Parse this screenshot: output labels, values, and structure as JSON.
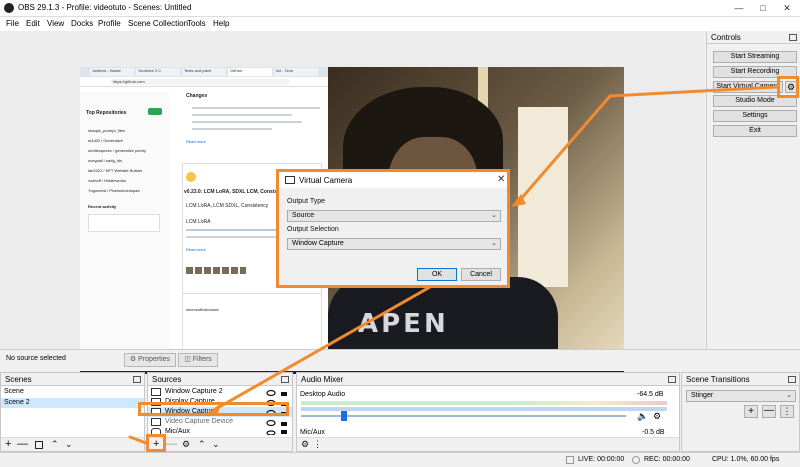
{
  "window": {
    "title": "OBS 29.1.3 - Profile: videotuto - Scenes: Untitled"
  },
  "menu": [
    "File",
    "Edit",
    "View",
    "Docks",
    "Profile",
    "Scene Collection",
    "Tools",
    "Help"
  ],
  "preview": {
    "browser_tabs": [
      "Justfont - Hacke",
      "Yourtube 2.0",
      "Texts and paint",
      "GitHub",
      "Art - Tech"
    ],
    "browser_url": "https://github.com",
    "sidebar_heading": "Top Repositories",
    "sidebar_items": [
      "shaqdx_prompt_files",
      "st1d32 / Generative",
      "orlofiesqueez / generative poetry",
      "oceypail / sadg_ids",
      "lan2021 / NFT Website Builder",
      "vozhoff / Hiddleworks",
      "Yugoneed / Pixelschoenspaa",
      "Recent activity"
    ],
    "changes_heading": "Changes",
    "release_title": "v0.23.0: LCM LoRA, SDXL LCM, Consistency Decoder from",
    "release_subtitle": "LCM LoRA, LCM SDXL, Consistency",
    "release_section": "LCM LoRA",
    "read_more": "Read more",
    "microsoft_repo": "microsoft/windows",
    "shirt_print": "APEN"
  },
  "dialog": {
    "title": "Virtual Camera",
    "output_type_label": "Output Type",
    "output_type_value": "Source",
    "output_selection_label": "Output Selection",
    "output_selection_value": "Window Capture",
    "ok_label": "OK",
    "cancel_label": "Cancel"
  },
  "controls": {
    "header": "Controls",
    "buttons": [
      "Start Streaming",
      "Start Recording",
      "Start Virtual Camera",
      "Studio Mode",
      "Settings",
      "Exit"
    ]
  },
  "source_status": {
    "no_source": "No source selected",
    "properties": "Properties",
    "filters": "Filters"
  },
  "scenes": {
    "header": "Scenes",
    "items": [
      "Scene",
      "Scene 2"
    ]
  },
  "sources": {
    "header": "Sources",
    "items": [
      "Window Capture 2",
      "Display Capture",
      "Window Capture",
      "Video Capture Device",
      "Mic/Aux"
    ]
  },
  "mixer": {
    "header": "Audio Mixer",
    "tracks": [
      {
        "name": "Desktop Audio",
        "db": "-64.5 dB"
      },
      {
        "name": "Mic/Aux",
        "db": "-0.5 dB"
      }
    ]
  },
  "transitions": {
    "header": "Scene Transitions",
    "value": "Stinger"
  },
  "statusbar": {
    "live": "LIVE: 00:00:00",
    "rec": "REC: 00:00:00",
    "cpu": "CPU: 1.0%, 60.00 fps"
  },
  "colors": {
    "annotation": "#f28b2e",
    "selection": "#cde8ff"
  }
}
